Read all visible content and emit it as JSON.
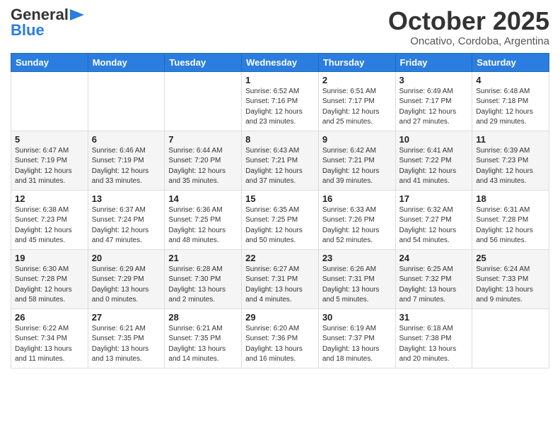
{
  "header": {
    "logo_general": "General",
    "logo_blue": "Blue",
    "month_title": "October 2025",
    "location": "Oncativo, Cordoba, Argentina"
  },
  "days_of_week": [
    "Sunday",
    "Monday",
    "Tuesday",
    "Wednesday",
    "Thursday",
    "Friday",
    "Saturday"
  ],
  "weeks": [
    [
      {
        "day": "",
        "info": ""
      },
      {
        "day": "",
        "info": ""
      },
      {
        "day": "",
        "info": ""
      },
      {
        "day": "1",
        "info": "Sunrise: 6:52 AM\nSunset: 7:16 PM\nDaylight: 12 hours\nand 23 minutes."
      },
      {
        "day": "2",
        "info": "Sunrise: 6:51 AM\nSunset: 7:17 PM\nDaylight: 12 hours\nand 25 minutes."
      },
      {
        "day": "3",
        "info": "Sunrise: 6:49 AM\nSunset: 7:17 PM\nDaylight: 12 hours\nand 27 minutes."
      },
      {
        "day": "4",
        "info": "Sunrise: 6:48 AM\nSunset: 7:18 PM\nDaylight: 12 hours\nand 29 minutes."
      }
    ],
    [
      {
        "day": "5",
        "info": "Sunrise: 6:47 AM\nSunset: 7:19 PM\nDaylight: 12 hours\nand 31 minutes."
      },
      {
        "day": "6",
        "info": "Sunrise: 6:46 AM\nSunset: 7:19 PM\nDaylight: 12 hours\nand 33 minutes."
      },
      {
        "day": "7",
        "info": "Sunrise: 6:44 AM\nSunset: 7:20 PM\nDaylight: 12 hours\nand 35 minutes."
      },
      {
        "day": "8",
        "info": "Sunrise: 6:43 AM\nSunset: 7:21 PM\nDaylight: 12 hours\nand 37 minutes."
      },
      {
        "day": "9",
        "info": "Sunrise: 6:42 AM\nSunset: 7:21 PM\nDaylight: 12 hours\nand 39 minutes."
      },
      {
        "day": "10",
        "info": "Sunrise: 6:41 AM\nSunset: 7:22 PM\nDaylight: 12 hours\nand 41 minutes."
      },
      {
        "day": "11",
        "info": "Sunrise: 6:39 AM\nSunset: 7:23 PM\nDaylight: 12 hours\nand 43 minutes."
      }
    ],
    [
      {
        "day": "12",
        "info": "Sunrise: 6:38 AM\nSunset: 7:23 PM\nDaylight: 12 hours\nand 45 minutes."
      },
      {
        "day": "13",
        "info": "Sunrise: 6:37 AM\nSunset: 7:24 PM\nDaylight: 12 hours\nand 47 minutes."
      },
      {
        "day": "14",
        "info": "Sunrise: 6:36 AM\nSunset: 7:25 PM\nDaylight: 12 hours\nand 48 minutes."
      },
      {
        "day": "15",
        "info": "Sunrise: 6:35 AM\nSunset: 7:25 PM\nDaylight: 12 hours\nand 50 minutes."
      },
      {
        "day": "16",
        "info": "Sunrise: 6:33 AM\nSunset: 7:26 PM\nDaylight: 12 hours\nand 52 minutes."
      },
      {
        "day": "17",
        "info": "Sunrise: 6:32 AM\nSunset: 7:27 PM\nDaylight: 12 hours\nand 54 minutes."
      },
      {
        "day": "18",
        "info": "Sunrise: 6:31 AM\nSunset: 7:28 PM\nDaylight: 12 hours\nand 56 minutes."
      }
    ],
    [
      {
        "day": "19",
        "info": "Sunrise: 6:30 AM\nSunset: 7:28 PM\nDaylight: 12 hours\nand 58 minutes."
      },
      {
        "day": "20",
        "info": "Sunrise: 6:29 AM\nSunset: 7:29 PM\nDaylight: 13 hours\nand 0 minutes."
      },
      {
        "day": "21",
        "info": "Sunrise: 6:28 AM\nSunset: 7:30 PM\nDaylight: 13 hours\nand 2 minutes."
      },
      {
        "day": "22",
        "info": "Sunrise: 6:27 AM\nSunset: 7:31 PM\nDaylight: 13 hours\nand 4 minutes."
      },
      {
        "day": "23",
        "info": "Sunrise: 6:26 AM\nSunset: 7:31 PM\nDaylight: 13 hours\nand 5 minutes."
      },
      {
        "day": "24",
        "info": "Sunrise: 6:25 AM\nSunset: 7:32 PM\nDaylight: 13 hours\nand 7 minutes."
      },
      {
        "day": "25",
        "info": "Sunrise: 6:24 AM\nSunset: 7:33 PM\nDaylight: 13 hours\nand 9 minutes."
      }
    ],
    [
      {
        "day": "26",
        "info": "Sunrise: 6:22 AM\nSunset: 7:34 PM\nDaylight: 13 hours\nand 11 minutes."
      },
      {
        "day": "27",
        "info": "Sunrise: 6:21 AM\nSunset: 7:35 PM\nDaylight: 13 hours\nand 13 minutes."
      },
      {
        "day": "28",
        "info": "Sunrise: 6:21 AM\nSunset: 7:35 PM\nDaylight: 13 hours\nand 14 minutes."
      },
      {
        "day": "29",
        "info": "Sunrise: 6:20 AM\nSunset: 7:36 PM\nDaylight: 13 hours\nand 16 minutes."
      },
      {
        "day": "30",
        "info": "Sunrise: 6:19 AM\nSunset: 7:37 PM\nDaylight: 13 hours\nand 18 minutes."
      },
      {
        "day": "31",
        "info": "Sunrise: 6:18 AM\nSunset: 7:38 PM\nDaylight: 13 hours\nand 20 minutes."
      },
      {
        "day": "",
        "info": ""
      }
    ]
  ]
}
